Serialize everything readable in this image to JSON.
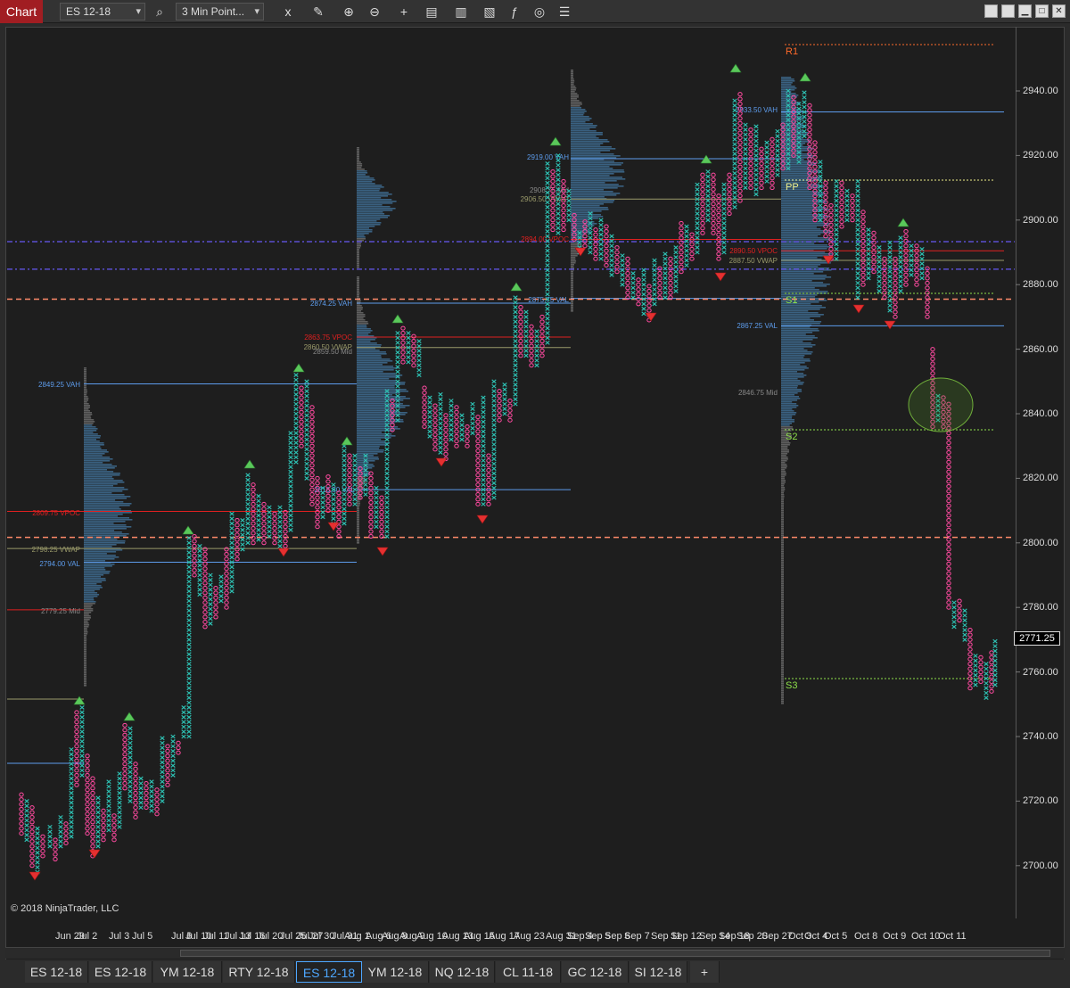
{
  "window": {
    "title": "Chart"
  },
  "toolbar": {
    "instrument": "ES 12-18",
    "bar_type": "3 Min Point...",
    "buttons": [
      {
        "name": "search-icon",
        "glyph": "⌕"
      },
      {
        "name": "remove-drawings-icon",
        "glyph": "x"
      },
      {
        "name": "pencil-icon",
        "glyph": "✎"
      },
      {
        "name": "zoom-in-icon",
        "glyph": "⊕"
      },
      {
        "name": "zoom-out-icon",
        "glyph": "⊖"
      },
      {
        "name": "crosshair-icon",
        "glyph": "+"
      },
      {
        "name": "data-box-icon",
        "glyph": "▤"
      },
      {
        "name": "bar-type-icon",
        "glyph": "▥"
      },
      {
        "name": "templates-icon",
        "glyph": "▧"
      },
      {
        "name": "indicators-icon",
        "glyph": "ƒ"
      },
      {
        "name": "strategies-icon",
        "glyph": "◎"
      },
      {
        "name": "properties-icon",
        "glyph": "☰"
      }
    ]
  },
  "chart": {
    "copyright": "© 2018 NinjaTrader, LLC",
    "current_price": "2771.25",
    "price_ticks": [
      {
        "label": "2940.00",
        "v": 2940
      },
      {
        "label": "2920.00",
        "v": 2920
      },
      {
        "label": "2900.00",
        "v": 2900
      },
      {
        "label": "2880.00",
        "v": 2880
      },
      {
        "label": "2860.00",
        "v": 2860
      },
      {
        "label": "2840.00",
        "v": 2840
      },
      {
        "label": "2820.00",
        "v": 2820
      },
      {
        "label": "2800.00",
        "v": 2800
      },
      {
        "label": "2780.00",
        "v": 2780
      },
      {
        "label": "2760.00",
        "v": 2760
      },
      {
        "label": "2740.00",
        "v": 2740
      },
      {
        "label": "2720.00",
        "v": 2720
      },
      {
        "label": "2700.00",
        "v": 2700
      }
    ],
    "date_labels": [
      "Jun 29",
      "Jul 2",
      "Jul 3",
      "Jul 5",
      "Jul 6",
      "Jul 10",
      "Jul 11",
      "Jul 13",
      "Jul 16",
      "Jul 20",
      "Jul 25",
      "Jul 27",
      "Jul 30",
      "Jul 31",
      "Aug 1",
      "Aug 6",
      "Aug 8",
      "Aug 9",
      "Aug 10",
      "Aug 13",
      "Aug 15",
      "Aug 17",
      "Aug 23",
      "Aug 31",
      "Sep 4",
      "Sep 5",
      "Sep 6",
      "Sep 7",
      "Sep 11",
      "Sep 12",
      "Sep 14",
      "Sep 18",
      "Sep 20",
      "Sep 27",
      "Oct 3",
      "Oct 4",
      "Oct 5",
      "Oct 8",
      "Oct 9",
      "Oct 10",
      "Oct 11"
    ],
    "levels": [
      {
        "label": "2849.25 VAH",
        "color": "#5d9cec"
      },
      {
        "label": "2809.75 VPOC",
        "color": "#e02020"
      },
      {
        "label": "2798.25 VWAP",
        "color": "#9a9a6a"
      },
      {
        "label": "2794.00 VAL",
        "color": "#5d9cec"
      },
      {
        "label": "2779.25 Mid",
        "color": "#888888"
      },
      {
        "label": "2816.50 VAL",
        "color": "#5d9cec"
      },
      {
        "label": "2874.25 VAH",
        "color": "#5d9cec"
      },
      {
        "label": "2863.75 VPOC",
        "color": "#e02020"
      },
      {
        "label": "2860.50 VWAP",
        "color": "#9a9a6a"
      },
      {
        "label": "2859.50 Mid",
        "color": "#888888"
      },
      {
        "label": "2919.00 VAH",
        "color": "#5d9cec"
      },
      {
        "label": "2908.75 Mid",
        "color": "#888888"
      },
      {
        "label": "2906.50 VWAP",
        "color": "#9a9a6a"
      },
      {
        "label": "2894.00 VPOC",
        "color": "#e02020"
      },
      {
        "label": "2875.75 VAL",
        "color": "#5d9cec"
      },
      {
        "label": "2933.50 VAH",
        "color": "#5d9cec"
      },
      {
        "label": "2890.50 VPOC",
        "color": "#e02020"
      },
      {
        "label": "2887.50 VWAP",
        "color": "#9a9a6a"
      },
      {
        "label": "2867.25 VAL",
        "color": "#5d9cec"
      },
      {
        "label": "2846.75 Mid",
        "color": "#888888"
      }
    ],
    "pivots": [
      {
        "label": "R1",
        "color": "#ff6a2a"
      },
      {
        "label": "PP",
        "color": "#eeee88"
      },
      {
        "label": "S1",
        "color": "#8ee04a"
      },
      {
        "label": "S2",
        "color": "#8ee04a"
      },
      {
        "label": "S3",
        "color": "#8ee04a"
      }
    ],
    "colors": {
      "up": "#2ec4b6",
      "down": "#ff4aa0",
      "background": "#1e1e1e"
    }
  },
  "tabs": [
    {
      "label": "ES 12-18",
      "active": false
    },
    {
      "label": "ES 12-18",
      "active": false
    },
    {
      "label": "YM 12-18",
      "active": false
    },
    {
      "label": "RTY 12-18",
      "active": false
    },
    {
      "label": "ES 12-18",
      "active": true
    },
    {
      "label": "YM 12-18",
      "active": false
    },
    {
      "label": "NQ 12-18",
      "active": false
    },
    {
      "label": "CL 11-18",
      "active": false
    },
    {
      "label": "GC 12-18",
      "active": false
    },
    {
      "label": "SI 12-18",
      "active": false
    }
  ],
  "add_tab_label": "+"
}
